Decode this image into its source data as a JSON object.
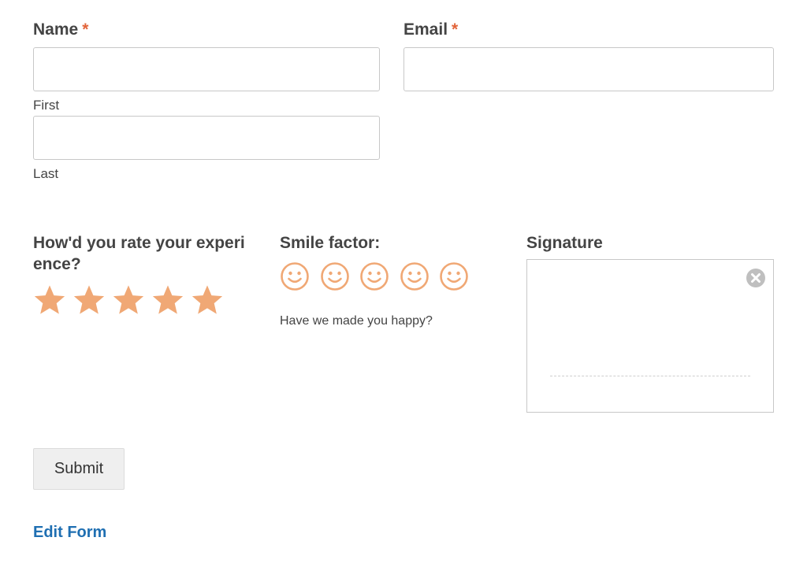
{
  "colors": {
    "required_marker": "#e2643a",
    "rating_accent": "#f0a875",
    "link": "#1f6fb2",
    "text": "#444444",
    "input_border": "#c8c8c8",
    "button_bg": "#efefef"
  },
  "name_field": {
    "label": "Name",
    "required_marker": "*",
    "first": {
      "value": "",
      "sublabel": "First"
    },
    "last": {
      "value": "",
      "sublabel": "Last"
    }
  },
  "email_field": {
    "label": "Email",
    "required_marker": "*",
    "value": ""
  },
  "star_rating": {
    "label_line1": "How'd you rate your experi",
    "label_line2": "ence?",
    "max": 5,
    "icon": "star-icon"
  },
  "smile_rating": {
    "label": "Smile factor:",
    "max": 5,
    "icon": "smiley-icon",
    "helper_text": "Have we made you happy?"
  },
  "signature": {
    "label": "Signature",
    "clear_icon": "close-circle-icon"
  },
  "submit_label": "Submit",
  "edit_link_label": "Edit Form"
}
